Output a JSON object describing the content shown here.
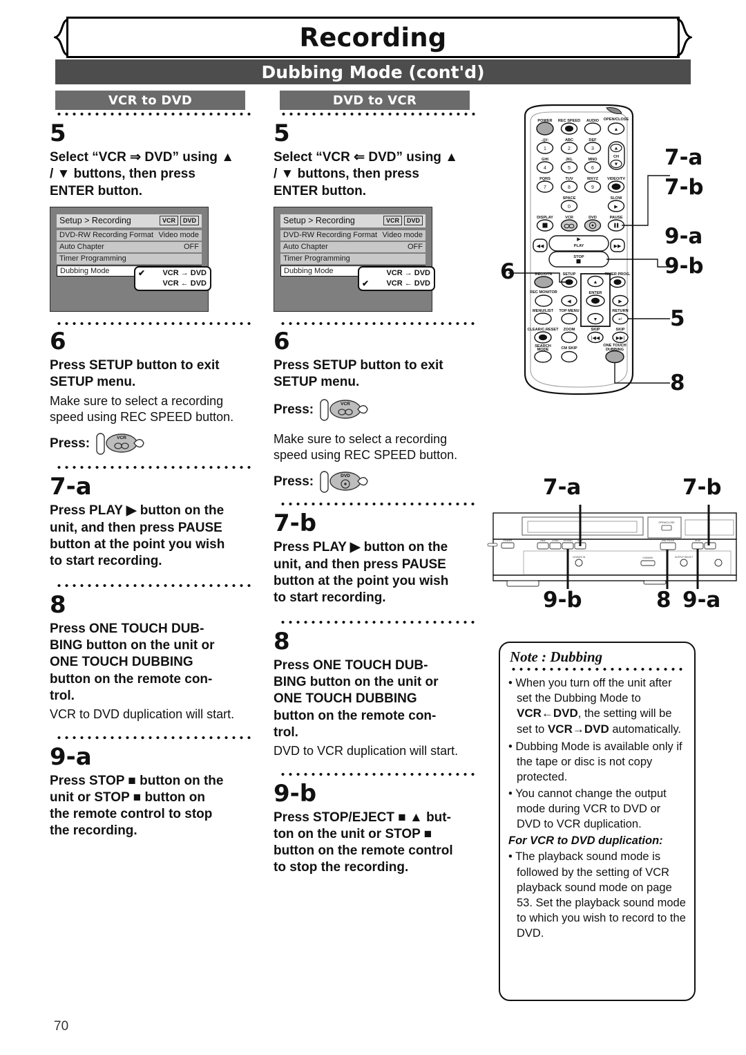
{
  "header": {
    "title": "Recording",
    "subtitle": "Dubbing Mode (cont'd)"
  },
  "sections": {
    "left_tag": "VCR to DVD",
    "mid_tag": "DVD to VCR"
  },
  "left_column": {
    "step5": {
      "number": "5",
      "title_line1": "Select “VCR ⇒ DVD” using ▲",
      "title_line2": "/ ▼ buttons, then press",
      "title_line3": "ENTER button."
    },
    "step6": {
      "number": "6",
      "title_line1": "Press SETUP button to exit",
      "title_line2": "SETUP menu.",
      "body_line1": "Make sure to select a recording",
      "body_line2": "speed using REC SPEED button.",
      "press_label": "Press:",
      "press_icon": "vcr-button-icon"
    },
    "step7a": {
      "number": "7-a",
      "title_line1": "Press PLAY ▶ button on the",
      "title_line2": "unit, and then press PAUSE",
      "title_line3": "button at the point you wish",
      "title_line4": "to start recording."
    },
    "step8": {
      "number": "8",
      "title_line1": "Press ONE TOUCH DUB-",
      "title_line2": "BING button on the unit or",
      "title_line3": "ONE TOUCH DUBBING",
      "title_line4": "button on the remote con-",
      "title_line5": "trol.",
      "body": "VCR to DVD duplication will start."
    },
    "step9a": {
      "number": "9-a",
      "title_line1": "Press STOP ■ button on the",
      "title_line2": "unit or STOP ■ button on",
      "title_line3": "the remote control to stop",
      "title_line4": "the recording."
    }
  },
  "mid_column": {
    "step5": {
      "number": "5",
      "title_line1": "Select “VCR ⇐ DVD” using ▲",
      "title_line2": "/ ▼ buttons, then press",
      "title_line3": "ENTER button."
    },
    "step6": {
      "number": "6",
      "title_line1": "Press SETUP button to exit",
      "title_line2": "SETUP menu.",
      "press_label_1": "Press:",
      "press_icon_1": "vcr-button-icon",
      "body_line1": "Make sure to select a recording",
      "body_line2": "speed using REC SPEED button.",
      "press_label_2": "Press:",
      "press_icon_2": "dvd-button-icon"
    },
    "step7b": {
      "number": "7-b",
      "title_line1": "Press PLAY ▶ button on the",
      "title_line2": "unit, and then press PAUSE",
      "title_line3": "button at the point you wish",
      "title_line4": "to start recording."
    },
    "step8": {
      "number": "8",
      "title_line1": "Press ONE TOUCH DUB-",
      "title_line2": "BING button on the unit or",
      "title_line3": "ONE TOUCH DUBBING",
      "title_line4": "button on the remote con-",
      "title_line5": "trol.",
      "body": "DVD to VCR duplication will start."
    },
    "step9b": {
      "number": "9-b",
      "title_line1": "Press STOP/EJECT ■ ▲ but-",
      "title_line2": "ton on the unit or STOP ■",
      "title_line3": "button on the remote control",
      "title_line4": "to stop the recording."
    }
  },
  "osd_left": {
    "title": "Setup > Recording",
    "badge_vcr": "VCR",
    "badge_dvd": "DVD",
    "rows": [
      {
        "label": "DVD-RW Recording Format",
        "value": "Video mode"
      },
      {
        "label": "Auto Chapter",
        "value": "OFF"
      },
      {
        "label": "Timer Programming",
        "value": ""
      },
      {
        "label": "Dubbing Mode",
        "value": ""
      }
    ],
    "popup": [
      {
        "check": "✔",
        "label": "VCR → DVD"
      },
      {
        "check": "",
        "label": "VCR ← DVD"
      }
    ]
  },
  "osd_mid": {
    "title": "Setup > Recording",
    "badge_vcr": "VCR",
    "badge_dvd": "DVD",
    "rows": [
      {
        "label": "DVD-RW Recording Format",
        "value": "Video mode"
      },
      {
        "label": "Auto Chapter",
        "value": "OFF"
      },
      {
        "label": "Timer Programming",
        "value": ""
      },
      {
        "label": "Dubbing Mode",
        "value": ""
      }
    ],
    "popup": [
      {
        "check": "",
        "label": "VCR → DVD"
      },
      {
        "check": "✔",
        "label": "VCR ← DVD"
      }
    ]
  },
  "remote": {
    "labels": {
      "power": "POWER",
      "rec_speed": "REC SPEED",
      "audio": "AUDIO",
      "open_close": "OPEN/CLOSE",
      "k1_top": ".@/:",
      "k1": "1",
      "k2_top": "ABC",
      "k2": "2",
      "k3_top": "DEF",
      "k3": "3",
      "k4_top": "GHI",
      "k4": "4",
      "k5_top": "JKL",
      "k5": "5",
      "k6_top": "MNO",
      "k6": "6",
      "k7_top": "PQRS",
      "k7": "7",
      "k8_top": "TUV",
      "k8": "8",
      "k9_top": "WXYZ",
      "k9": "9",
      "k0_top": "SPACE",
      "k0": "0",
      "ch": "CH",
      "video_tv": "VIDEO/TV",
      "slow": "SLOW",
      "display": "DISPLAY",
      "vcr": "VCR",
      "dvd": "DVD",
      "pause": "PAUSE",
      "play": "PLAY",
      "stop": "STOP",
      "rec_otr": "REC/OTR",
      "setup": "SETUP",
      "timer_prog": "TIMER PROG.",
      "rec_monitor": "REC MONITOR",
      "enter": "ENTER",
      "menu_list": "MENU/LIST",
      "top_menu": "TOP MENU",
      "return": "RETURN",
      "clear_creset": "CLEAR/C.RESET",
      "zoom": "ZOOM",
      "skip_left": "SKIP",
      "skip_right": "SKIP",
      "search_mode": "SEARCH MODE",
      "cm_skip": "CM SKIP",
      "one_touch_dubbing": "ONE TOUCH DUBBING"
    },
    "callouts": {
      "c7a": "7-a",
      "c7b": "7-b",
      "c9a": "9-a",
      "c9b": "9-b",
      "c5": "5",
      "c6": "6",
      "c8": "8"
    }
  },
  "unit": {
    "callouts": {
      "top_left": "7-a",
      "top_right": "7-b",
      "bottom_left": "9-b",
      "bottom_mid": "8",
      "bottom_right": "9-a"
    }
  },
  "note": {
    "heading": "Note : Dubbing",
    "items": [
      {
        "pre": "• When you turn off the unit after set the Dubbing Mode to ",
        "arrow1": "VCR←DVD",
        "mid": ", the setting will be set to ",
        "arrow2": "VCR→DVD",
        "post": " automatically."
      },
      {
        "text": "• Dubbing Mode is available only if the tape or disc is not copy protected."
      },
      {
        "text": "• You cannot change the output mode during VCR to DVD or DVD to VCR duplication."
      }
    ],
    "subheading": "For VCR to DVD duplication:",
    "sub_items": [
      {
        "text": "• The playback sound mode is followed by the setting of VCR playback sound mode on page 53. Set the playback sound mode to which you wish to record to the DVD."
      }
    ]
  },
  "page_number": "70"
}
